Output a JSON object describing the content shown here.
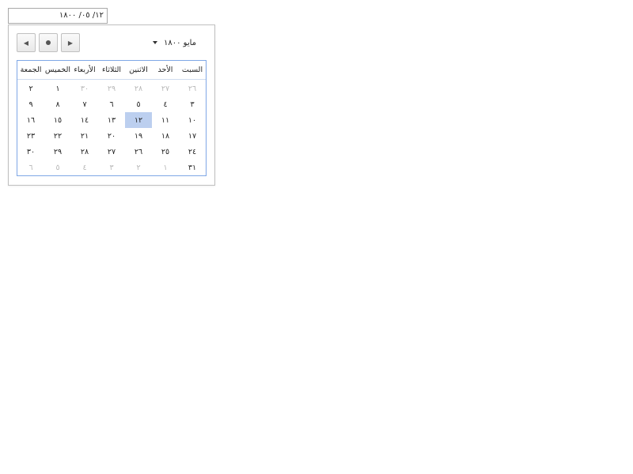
{
  "date_input": {
    "value": "١٢/ ٠٥/ ١٨٠٠"
  },
  "picker": {
    "month_label": "مايو ١٨٠٠",
    "nav": {
      "prev_icon": "triangle-left-icon",
      "today_icon": "dot-icon",
      "next_icon": "triangle-right-icon"
    },
    "weekdays": [
      "السبت",
      "الأحد",
      "الاثنين",
      "الثلاثاء",
      "الأربعاء",
      "الخميس",
      "الجمعة"
    ],
    "weeks": [
      [
        {
          "t": "٢٦",
          "o": true
        },
        {
          "t": "٢٧",
          "o": true
        },
        {
          "t": "٢٨",
          "o": true
        },
        {
          "t": "٢٩",
          "o": true
        },
        {
          "t": "٣٠",
          "o": true
        },
        {
          "t": "١"
        },
        {
          "t": "٢"
        }
      ],
      [
        {
          "t": "٣"
        },
        {
          "t": "٤"
        },
        {
          "t": "٥"
        },
        {
          "t": "٦"
        },
        {
          "t": "٧"
        },
        {
          "t": "٨"
        },
        {
          "t": "٩"
        }
      ],
      [
        {
          "t": "١٠"
        },
        {
          "t": "١١"
        },
        {
          "t": "١٢",
          "s": true
        },
        {
          "t": "١٣"
        },
        {
          "t": "١٤"
        },
        {
          "t": "١٥"
        },
        {
          "t": "١٦"
        }
      ],
      [
        {
          "t": "١٧"
        },
        {
          "t": "١٨"
        },
        {
          "t": "١٩"
        },
        {
          "t": "٢٠"
        },
        {
          "t": "٢١"
        },
        {
          "t": "٢٢"
        },
        {
          "t": "٢٣"
        }
      ],
      [
        {
          "t": "٢٤"
        },
        {
          "t": "٢٥"
        },
        {
          "t": "٢٦"
        },
        {
          "t": "٢٧"
        },
        {
          "t": "٢٨"
        },
        {
          "t": "٢٩"
        },
        {
          "t": "٣٠"
        }
      ],
      [
        {
          "t": "٣١"
        },
        {
          "t": "١",
          "o": true
        },
        {
          "t": "٢",
          "o": true
        },
        {
          "t": "٣",
          "o": true
        },
        {
          "t": "٤",
          "o": true
        },
        {
          "t": "٥",
          "o": true
        },
        {
          "t": "٦",
          "o": true
        }
      ]
    ],
    "colors": {
      "selected_bg": "#bccfef",
      "grid_border": "#7fa7e6",
      "other_month_text": "#b8b8b8"
    }
  }
}
